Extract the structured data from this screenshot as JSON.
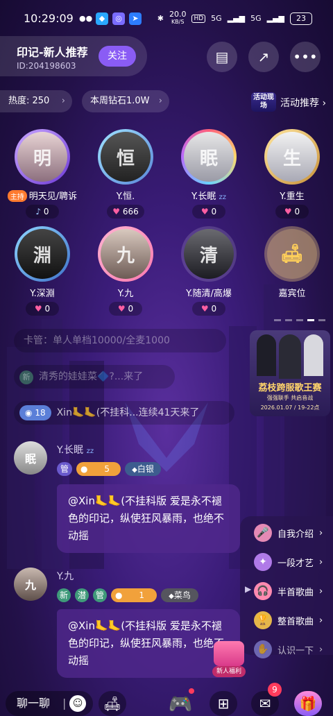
{
  "status_bar": {
    "time": "10:29:09",
    "net_speed_top": "20.0",
    "net_speed_unit": "KB/S",
    "hd": "HD",
    "sig1": "5G",
    "sig2": "5G",
    "battery": "23"
  },
  "room": {
    "title": "印记-新人推荐",
    "id": "ID:204198603",
    "follow_label": "关注"
  },
  "stats": {
    "heat": "热度: 250",
    "diamonds": "本周钻石1.0W",
    "activity_badge": "活动现场",
    "activity_label": "活动推荐"
  },
  "seats": [
    {
      "name": "明天见/聘诉",
      "count": "0",
      "host_tag": "主持",
      "count_icon": "music-note"
    },
    {
      "name": "Y.恒.",
      "count": "666"
    },
    {
      "name": "Y.长眠",
      "count": "0"
    },
    {
      "name": "Y.重生",
      "count": "0"
    },
    {
      "name": "Y.深淵",
      "count": "0"
    },
    {
      "name": "Y.九",
      "count": "0"
    },
    {
      "name": "Y.随清/高爆",
      "count": "0"
    },
    {
      "name": "嘉宾位",
      "count": ""
    }
  ],
  "chat": {
    "notice": "卡管：单人单档10000/全麦1000",
    "join1_tag": "新",
    "join1": "清秀的娃娃菜🔷?...来了",
    "join2_level": "18",
    "join2": "Xin🦶🦶(不挂科...连续41天来了",
    "messages": [
      {
        "name": "Y.长眠",
        "tags": [
          "管",
          "5",
          "白银"
        ],
        "text": "@Xin🦶🦶(不挂科版 爱是永不褪色的印记，纵使狂风暴雨，也绝不动摇"
      },
      {
        "name": "Y.九",
        "tags": [
          "新",
          "潜",
          "管",
          "1",
          "菜鸟"
        ],
        "text": "@Xin🦶🦶(不挂科版 爱是永不褪色的印记，纵使狂风暴雨，也绝不动摇"
      }
    ]
  },
  "banner": {
    "title": "荔枝跨服歌王赛",
    "subtitle": "强强联手 共启音战",
    "date": "2026.01.07 / 19-22点"
  },
  "side_menu": [
    "自我介绍",
    "一段才艺",
    "半首歌曲",
    "整首歌曲",
    "认识一下"
  ],
  "newbie_badge": "新人福利",
  "bottom": {
    "chat_placeholder": "聊一聊",
    "message_count": "9"
  },
  "colors": {
    "accent": "#8a5cf5",
    "heart": "#ff5fa2",
    "host_tag": "#ff7a2e"
  }
}
